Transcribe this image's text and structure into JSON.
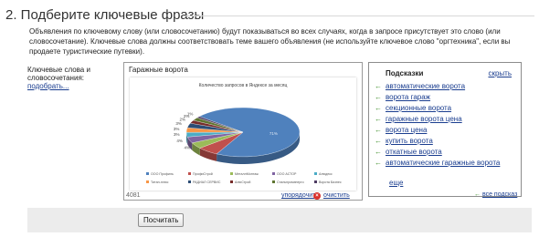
{
  "section": {
    "title": "2. Подберите ключевые фразы",
    "description": "Объявления по ключевому слову (или словосочетанию) будут показываться во всех случаях, когда в запросе присутствует это слово (или словосочетание). Ключевые слова должны соответствовать теме вашего объявления (не используйте ключевое слово \"оргтехника\", если вы продаете туристические путевки)."
  },
  "keywords": {
    "label": "Ключевые слова и словосочетания:",
    "pick_link": "подобрать...",
    "first_line": "Гаражные ворота",
    "counter": "4081",
    "sort_link": "упорядочить",
    "clear_link": "очистить"
  },
  "chart_data": {
    "type": "pie",
    "title": "Количество запросов в Яндексе за месяц",
    "slices": [
      {
        "name": "ООО Профиль",
        "value": 71,
        "label": "71%",
        "color": "#4f81bd"
      },
      {
        "name": "ПрофиСтрой",
        "value": 6,
        "label": "",
        "color": "#c0504d"
      },
      {
        "name": "МеталлМонтаж",
        "value": 4,
        "label": "4%",
        "color": "#9bbb59"
      },
      {
        "name": "ООО АСТОР",
        "value": 4,
        "label": "4%",
        "color": "#8064a2"
      },
      {
        "name": "Алюдекс",
        "value": 3,
        "label": "3%",
        "color": "#4bacc6"
      },
      {
        "name": "Титан-плюс",
        "value": 3,
        "label": "3%",
        "color": "#f79646"
      },
      {
        "name": "РАДИАЛ СЕРВИС",
        "value": 3,
        "label": "3%",
        "color": "#2c4d75"
      },
      {
        "name": "АлюСтрой",
        "value": 2,
        "label": "2%",
        "color": "#772c2a"
      },
      {
        "name": "Стальпромэнерго",
        "value": 2,
        "label": "2%",
        "color": "#5f7530"
      },
      {
        "name": "Ворота Бизнес",
        "value": 1,
        "label": "1%",
        "color": "#4d3b62"
      }
    ]
  },
  "hints": {
    "title": "Подсказки",
    "hide_link": "скрыть",
    "items": [
      "автоматические ворота",
      "ворота гараж",
      "секционные ворота",
      "гаражные ворота цена",
      "ворота цена",
      "купить ворота",
      "откатные ворота",
      "автоматические гаражные ворота"
    ],
    "more_link": "еще",
    "all_hints_link": "все подсказ"
  },
  "actions": {
    "calculate": "Посчитать"
  },
  "colors": {
    "link": "#1a3d8f",
    "arrow": "#3f8f2a",
    "bar": "#ececec"
  }
}
